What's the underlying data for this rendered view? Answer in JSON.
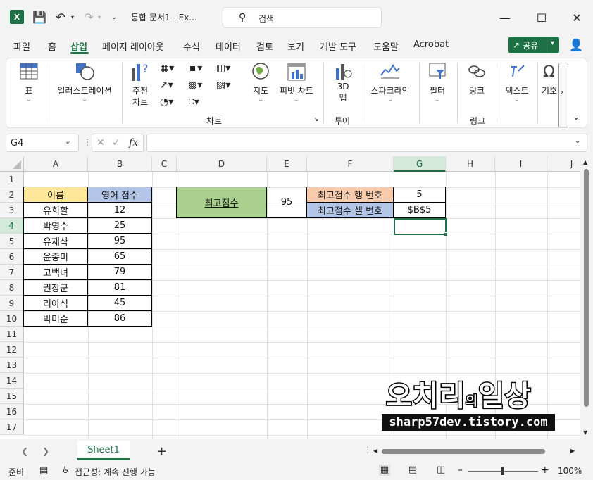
{
  "window": {
    "title": "통합 문서1  -  Ex...",
    "search_placeholder": "검색",
    "app_icon_letter": "X"
  },
  "menu": {
    "tabs": [
      "파일",
      "홈",
      "삽입",
      "페이지 레이아웃",
      "수식",
      "데이터",
      "검토",
      "보기",
      "개발 도구",
      "도움말",
      "Acrobat"
    ],
    "active_tab": "삽입",
    "share_label": "공유"
  },
  "ribbon": {
    "table": "표",
    "illustrations": "일러스트레이션",
    "recommended_charts_line1": "추천",
    "recommended_charts_line2": "차트",
    "maps": "지도",
    "pivot_chart": "피벗 차트",
    "charts_group": "차트",
    "map3d_line1": "3D",
    "map3d_line2": "맵",
    "tours_group": "투어",
    "sparklines": "스파크라인",
    "filters": "필터",
    "link": "링크",
    "links_group": "링크",
    "text": "텍스트",
    "symbols": "기호"
  },
  "formula_bar": {
    "name_box": "G4",
    "fx": "fx",
    "formula": ""
  },
  "grid": {
    "columns": [
      "A",
      "B",
      "C",
      "D",
      "E",
      "F",
      "G",
      "H",
      "I",
      "J"
    ],
    "selected_column": "G",
    "rows": [
      "1",
      "2",
      "3",
      "4",
      "5",
      "6",
      "7",
      "8",
      "9",
      "10",
      "11",
      "12",
      "13",
      "14",
      "15",
      "16",
      "17"
    ],
    "selected_row": "4",
    "table_header": {
      "name": "이름",
      "score": "영어 점수"
    },
    "students": [
      {
        "name": "유희할",
        "score": "12"
      },
      {
        "name": "박영수",
        "score": "25"
      },
      {
        "name": "유재샥",
        "score": "95"
      },
      {
        "name": "윤종미",
        "score": "65"
      },
      {
        "name": "고백녀",
        "score": "79"
      },
      {
        "name": "권장군",
        "score": "81"
      },
      {
        "name": "리아식",
        "score": "45"
      },
      {
        "name": "박미순",
        "score": "86"
      }
    ],
    "max_label": "최고점수",
    "max_value": "95",
    "row_num_label": "최고점수 행 번호",
    "row_num_value": "5",
    "cell_addr_label": "최고점수 셀 번호",
    "cell_addr_value": "$B$5"
  },
  "watermark": {
    "title_part1": "오치리",
    "title_small": "의",
    "title_part2": "일상",
    "url": "sharp57dev.tistory.com"
  },
  "sheets": {
    "active": "Sheet1",
    "add": "+"
  },
  "status": {
    "ready": "준비",
    "accessibility": "접근성: 계속 진행 가능",
    "zoom": "100%"
  },
  "colors": {
    "excel_green": "#1e7145",
    "yellow": "#ffe699",
    "blue": "#b4c6e7",
    "green": "#a9d08e",
    "peach": "#f8cbad"
  }
}
